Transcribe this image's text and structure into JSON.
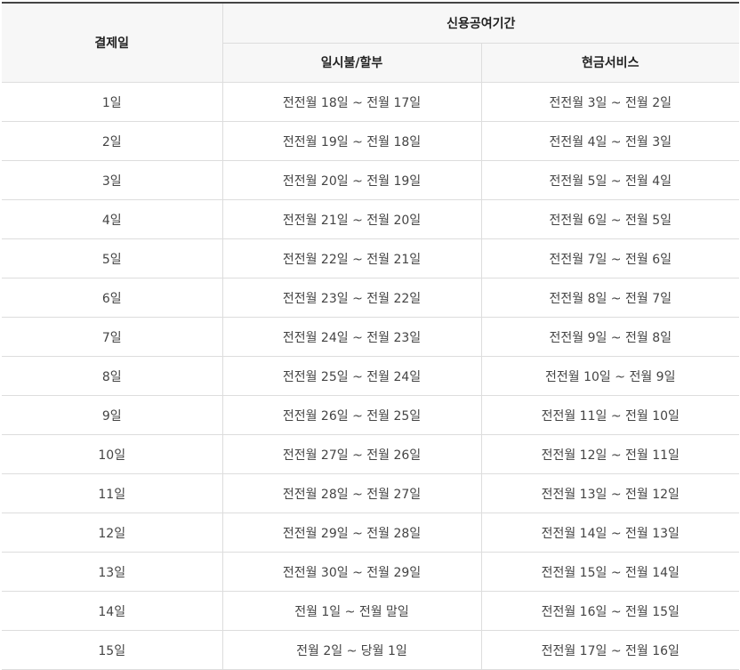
{
  "table": {
    "header": {
      "payment_date": "결제일",
      "credit_period": "신용공여기간",
      "installment": "일시불/할부",
      "cash_service": "현금서비스"
    },
    "rows": [
      {
        "payment_date": "1일",
        "installment": "전전월 18일 ~ 전월 17일",
        "cash_service": "전전월 3일 ~ 전월 2일"
      },
      {
        "payment_date": "2일",
        "installment": "전전월 19일 ~ 전월 18일",
        "cash_service": "전전월 4일 ~ 전월 3일"
      },
      {
        "payment_date": "3일",
        "installment": "전전월 20일 ~ 전월 19일",
        "cash_service": "전전월 5일 ~ 전월 4일"
      },
      {
        "payment_date": "4일",
        "installment": "전전월 21일 ~ 전월 20일",
        "cash_service": "전전월 6일 ~ 전월 5일"
      },
      {
        "payment_date": "5일",
        "installment": "전전월 22일 ~ 전월 21일",
        "cash_service": "전전월 7일 ~ 전월 6일"
      },
      {
        "payment_date": "6일",
        "installment": "전전월 23일 ~ 전월 22일",
        "cash_service": "전전월 8일 ~ 전월 7일"
      },
      {
        "payment_date": "7일",
        "installment": "전전월 24일 ~ 전월 23일",
        "cash_service": "전전월 9일 ~ 전월 8일"
      },
      {
        "payment_date": "8일",
        "installment": "전전월 25일 ~ 전월 24일",
        "cash_service": "전전월 10일 ~ 전월 9일"
      },
      {
        "payment_date": "9일",
        "installment": "전전월 26일 ~ 전월 25일",
        "cash_service": "전전월 11일 ~ 전월 10일"
      },
      {
        "payment_date": "10일",
        "installment": "전전월 27일 ~ 전월 26일",
        "cash_service": "전전월 12일 ~ 전월 11일"
      },
      {
        "payment_date": "11일",
        "installment": "전전월 28일 ~ 전월 27일",
        "cash_service": "전전월 13일 ~ 전월 12일"
      },
      {
        "payment_date": "12일",
        "installment": "전전월 29일 ~ 전월 28일",
        "cash_service": "전전월 14일 ~ 전월 13일"
      },
      {
        "payment_date": "13일",
        "installment": "전전월 30일 ~ 전월 29일",
        "cash_service": "전전월 15일 ~ 전월 14일"
      },
      {
        "payment_date": "14일",
        "installment": "전월 1일 ~ 전월 말일",
        "cash_service": "전전월 16일 ~ 전월 15일"
      },
      {
        "payment_date": "15일",
        "installment": "전월 2일 ~ 당월 1일",
        "cash_service": "전전월 17일 ~ 전월 16일"
      }
    ]
  }
}
